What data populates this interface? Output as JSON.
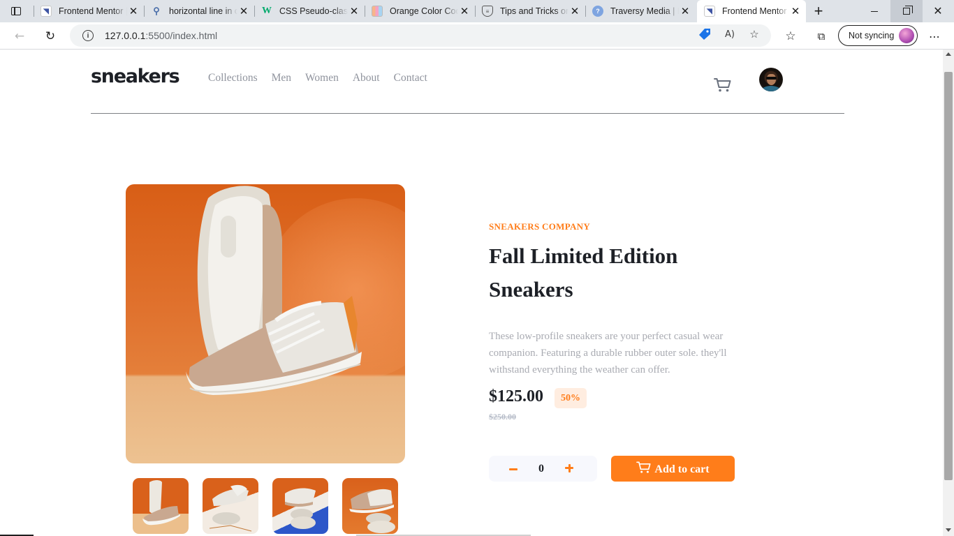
{
  "browser": {
    "tabs": [
      {
        "title": "Frontend Mentor | E-commerce product page",
        "favicon": "frontend-mentor-icon",
        "active": false
      },
      {
        "title": "horizontal line in css",
        "favicon": "search-icon",
        "active": false
      },
      {
        "title": "CSS Pseudo-classes",
        "favicon": "w3schools-icon",
        "active": false
      },
      {
        "title": "Orange Color Codes",
        "favicon": "color-grid-icon",
        "active": false
      },
      {
        "title": "Tips and Tricks on CSS",
        "favicon": "shield-icon",
        "active": false
      },
      {
        "title": "Traversy Media | Learn",
        "favicon": "globe-icon",
        "active": false
      },
      {
        "title": "Frontend Mentor",
        "favicon": "frontend-mentor-icon",
        "active": true
      }
    ],
    "url_host": "127.0.0.1",
    "url_rest": ":5500/index.html",
    "sync_label": "Not syncing"
  },
  "site": {
    "logo": "sneakers",
    "nav": [
      "Collections",
      "Men",
      "Women",
      "About",
      "Contact"
    ]
  },
  "product": {
    "company": "SNEAKERS COMPANY",
    "title": "Fall Limited Edition Sneakers",
    "description": "These low-profile sneakers are your perfect casual wear companion. Featuring a durable rubber outer sole. they'll withstand everything the weather can offer.",
    "price": "$125.00",
    "discount": "50%",
    "old_price": "$250.00",
    "quantity": "0",
    "add_to_cart": "Add to cart"
  },
  "colors": {
    "accent": "#ff7d1a",
    "accent_pale": "#ffede0",
    "dark_text": "#1d2026",
    "muted_text": "#8f939d"
  }
}
